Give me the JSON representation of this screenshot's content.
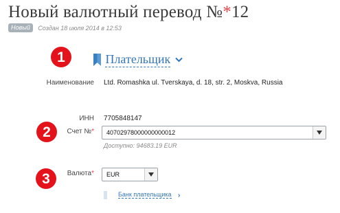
{
  "header": {
    "title": "Новый валютный перевод №",
    "title_required_mark": "*",
    "title_number": "12",
    "status_badge": "Новый",
    "created_text": "Создан 18 июля 2014 в 12:53"
  },
  "steps": [
    "1",
    "2",
    "3"
  ],
  "payer_section": {
    "title": "Плательщик",
    "name_label": "Наименование",
    "name_value": "Ltd. Romashka ul. Tverskaya, d. 18, str. 2, Moskva, Russia",
    "inn_label": "ИНН",
    "inn_value": "7705848147",
    "account_label": "Счет №",
    "account_required_mark": "*",
    "account_value": "40702978000000000012",
    "available_text": "Доступно: 94683.19 EUR",
    "currency_label": "Валюта",
    "currency_required_mark": "*",
    "currency_value": "EUR",
    "bank_link": "Банк плательщика"
  },
  "colors": {
    "accent_blue": "#3476b9",
    "step_red": "#e4131b",
    "required_red": "#e0454b"
  },
  "icons": {
    "section": "bookmark-icon",
    "section_toggle": "chevron-down-icon",
    "select_arrow": "dropdown-arrow-icon",
    "bank_link": "chevron-right-icon"
  }
}
